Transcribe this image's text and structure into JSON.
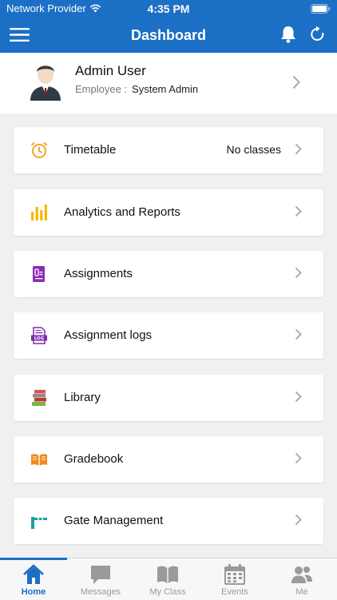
{
  "status": {
    "carrier": "Network Provider",
    "time": "4:35 PM"
  },
  "navbar": {
    "title": "Dashboard"
  },
  "profile": {
    "name": "Admin User",
    "role_label": "Employee :",
    "role_value": "System Admin"
  },
  "menu": [
    {
      "label": "Timetable",
      "value": "No classes",
      "icon": "alarm-clock-icon",
      "color": "#f5a623"
    },
    {
      "label": "Analytics and Reports",
      "icon": "bar-chart-icon",
      "color": "#f5b800"
    },
    {
      "label": "Assignments",
      "icon": "assignment-icon",
      "color": "#8a2bb5"
    },
    {
      "label": "Assignment logs",
      "icon": "log-document-icon",
      "color": "#7b2aa8"
    },
    {
      "label": "Library",
      "icon": "books-icon",
      "color": "#5a8f3a"
    },
    {
      "label": "Gradebook",
      "icon": "open-book-icon",
      "color": "#f08a1c"
    },
    {
      "label": "Gate Management",
      "icon": "gate-barrier-icon",
      "color": "#1aa0a0"
    }
  ],
  "tabs": [
    {
      "label": "Home",
      "icon": "home-icon",
      "active": true
    },
    {
      "label": "Messages",
      "icon": "message-icon"
    },
    {
      "label": "My Class",
      "icon": "book-icon"
    },
    {
      "label": "Events",
      "icon": "calendar-icon"
    },
    {
      "label": "Me",
      "icon": "people-icon"
    }
  ],
  "colors": {
    "primary": "#1b6fc4",
    "background": "#f0f0f0"
  }
}
